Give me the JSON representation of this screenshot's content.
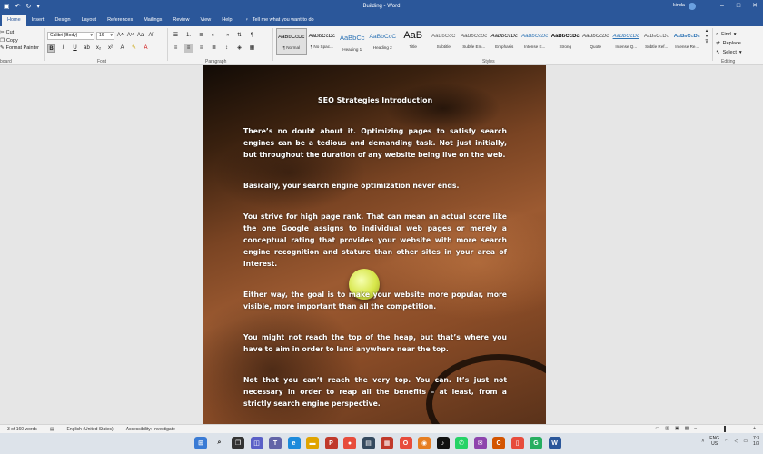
{
  "titlebar": {
    "title": "Building  -  Word",
    "user": "kinda",
    "qa_icons": [
      "save-icon",
      "undo-icon",
      "redo-icon"
    ]
  },
  "tabs": [
    "Home",
    "Insert",
    "Design",
    "Layout",
    "References",
    "Mailings",
    "Review",
    "View",
    "Help"
  ],
  "tellme": "Tell me what you want to do",
  "clipboard": {
    "cut": "Cut",
    "copy": "Copy",
    "format_painter": "Format Painter",
    "group": "board"
  },
  "font": {
    "name": "Calibri (Body)",
    "size": "16",
    "group": "Font"
  },
  "paragraph": {
    "group": "Paragraph"
  },
  "styles": {
    "group": "Styles",
    "items": [
      {
        "preview": "AaBbCcDc",
        "name": "¶ Normal"
      },
      {
        "preview": "AaBbCcDc",
        "name": "¶ No Spac..."
      },
      {
        "preview": "AaBbCc",
        "name": "Heading 1"
      },
      {
        "preview": "AaBbCcC",
        "name": "Heading 2"
      },
      {
        "preview": "AaB",
        "name": "Title"
      },
      {
        "preview": "AaBbCcC",
        "name": "Subtitle"
      },
      {
        "preview": "AaBbCcDc",
        "name": "Subtle Em..."
      },
      {
        "preview": "AaBbCcDc",
        "name": "Emphasis"
      },
      {
        "preview": "AaBbCcDc",
        "name": "Intense E..."
      },
      {
        "preview": "AaBbCcDc",
        "name": "Strong"
      },
      {
        "preview": "AaBbCcDc",
        "name": "Quote"
      },
      {
        "preview": "AaBbCcDc",
        "name": "Intense Q..."
      },
      {
        "preview": "AaBbCcDc",
        "name": "Subtle Ref..."
      },
      {
        "preview": "AaBbCcDc",
        "name": "Intense Re..."
      }
    ]
  },
  "editing": {
    "find": "Find",
    "replace": "Replace",
    "select": "Select",
    "group": "Editing"
  },
  "document": {
    "title": "SEO Strategies Introduction",
    "paragraphs": [
      "There’s no doubt about it. Optimizing pages to satisfy search engines can be a tedious and demanding task. Not just initially, but throughout the duration of any website being live on the web.",
      "Basically, your search engine optimization never ends.",
      "You strive for high page rank. That can mean an actual score like the one Google assigns to individual web pages or merely a conceptual rating that provides your website with more search engine recognition and stature than other sites in your area of interest.",
      "Either way, the goal is to make your website more popular, more visible, more important than all the competition.",
      "You might not reach the top of the heap, but that’s where you have to aim in order to land anywhere near the top.",
      "Not that you can’t reach the very top. You can. It’s just not necessary in order to reap all the benefits – at least, from a strictly search engine perspective."
    ]
  },
  "status": {
    "words": "3 of 160 words",
    "language": "English (United States)",
    "accessibility": "Accessibility: Investigate"
  },
  "tray": {
    "lang1": "ENG",
    "lang2": "US",
    "time": "7:3",
    "date": "1/3"
  },
  "colors": {
    "accent": "#2b579a"
  }
}
